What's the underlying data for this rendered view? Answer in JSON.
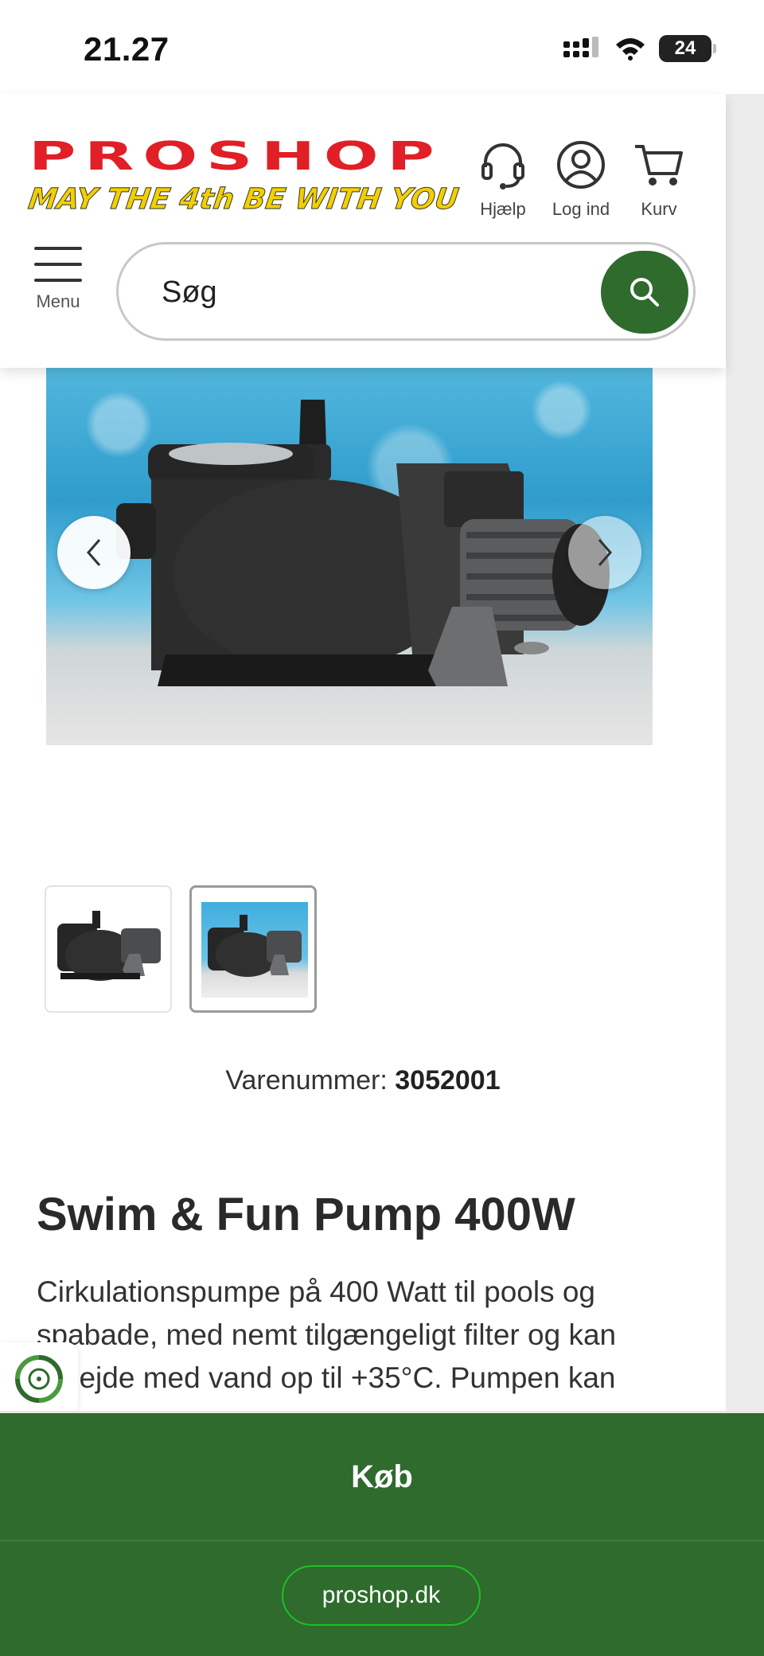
{
  "status_bar": {
    "time": "21.27",
    "battery": "24"
  },
  "header": {
    "logo_text": "PROSHOP",
    "tagline": "MAY THE 4th BE WITH YOU",
    "actions": [
      {
        "label": "Hjælp",
        "icon": "headset-icon"
      },
      {
        "label": "Log ind",
        "icon": "user-icon"
      },
      {
        "label": "Kurv",
        "icon": "cart-icon"
      }
    ],
    "menu_label": "Menu",
    "search_placeholder": "Søg"
  },
  "colors": {
    "brand_red": "#e01f26",
    "brand_green": "#2e6b2c",
    "tagline_yellow": "#f2d000"
  },
  "product": {
    "sku_label": "Varenummer:",
    "sku": "3052001",
    "title": "Swim & Fun Pump 400W",
    "description": "Cirkulationspumpe på 400 Watt til pools og spabade, med nemt tilgængeligt filter og kan arbejde med vand op til +35°C. Pumpen kan"
  },
  "bottom": {
    "buy_label": "Køb",
    "url": "proshop.dk"
  }
}
